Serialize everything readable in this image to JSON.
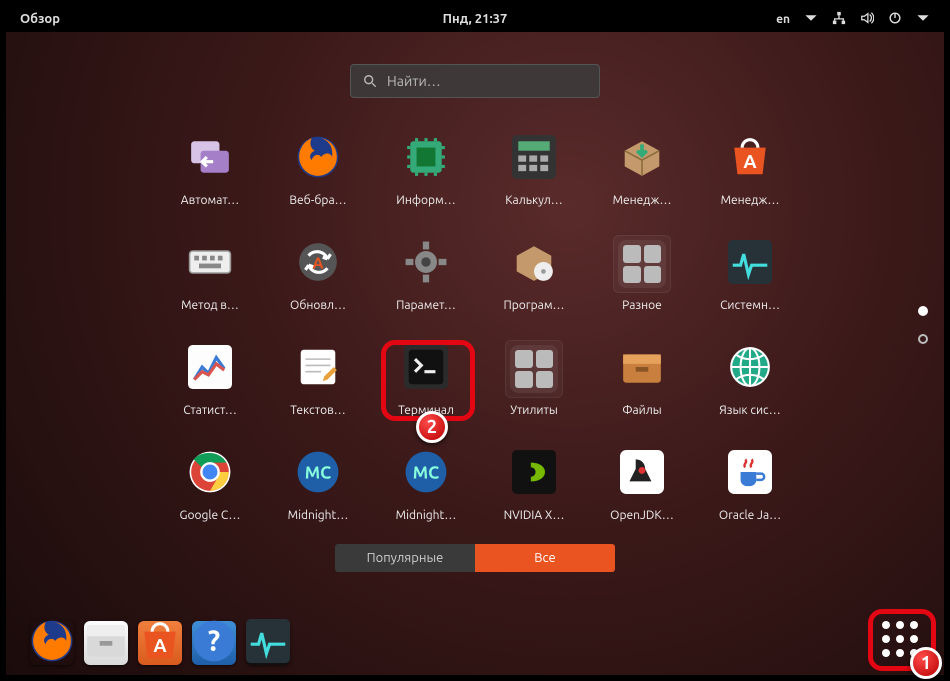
{
  "topbar": {
    "overview_label": "Обзор",
    "clock": "Пнд, 21:37",
    "lang": "en"
  },
  "search": {
    "placeholder": "Найти…"
  },
  "apps": [
    {
      "label": "Автомат…",
      "name": "app-startup",
      "icon": "window-arrow",
      "bg": "g-purple"
    },
    {
      "label": "Веб-бра…",
      "name": "app-firefox",
      "icon": "firefox",
      "bg": ""
    },
    {
      "label": "Информ…",
      "name": "app-sysinfo",
      "icon": "chip",
      "bg": "g-grey"
    },
    {
      "label": "Калькул…",
      "name": "app-calculator",
      "icon": "calc",
      "bg": "g-dark"
    },
    {
      "label": "Менедж…",
      "name": "app-archive",
      "icon": "box-down",
      "bg": "g-box"
    },
    {
      "label": "Менедж…",
      "name": "app-software",
      "icon": "bag-a",
      "bg": "g-orange"
    },
    {
      "label": "Метод в…",
      "name": "app-input-method",
      "icon": "keyboard",
      "bg": "g-white"
    },
    {
      "label": "Обновл…",
      "name": "app-updater",
      "icon": "refresh-a",
      "bg": "g-grey"
    },
    {
      "label": "Парамет…",
      "name": "app-settings",
      "icon": "gear",
      "bg": "g-grey"
    },
    {
      "label": "Програм…",
      "name": "app-software-prop",
      "icon": "box-cd",
      "bg": "g-box"
    },
    {
      "label": "Разное",
      "name": "folder-misc",
      "icon": "folder",
      "bg": "",
      "folder": true
    },
    {
      "label": "Системн…",
      "name": "app-sysmonitor",
      "icon": "ecg",
      "bg": "g-dark"
    },
    {
      "label": "Статист…",
      "name": "app-powerstats",
      "icon": "chart",
      "bg": "g-white"
    },
    {
      "label": "Текстов…",
      "name": "app-gedit",
      "icon": "notepad",
      "bg": "g-white"
    },
    {
      "label": "Терминал",
      "name": "app-terminal",
      "icon": "terminal",
      "bg": "g-dark",
      "highlighted": true,
      "badge": "2"
    },
    {
      "label": "Утилиты",
      "name": "folder-utilities",
      "icon": "folder",
      "bg": "",
      "folder": true
    },
    {
      "label": "Файлы",
      "name": "app-files",
      "icon": "drawer",
      "bg": "g-orange"
    },
    {
      "label": "Язык сис…",
      "name": "app-language",
      "icon": "globe",
      "bg": "g-teal"
    },
    {
      "label": "Google C…",
      "name": "app-chrome",
      "icon": "chrome",
      "bg": ""
    },
    {
      "label": "Midnight…",
      "name": "app-mc1",
      "icon": "mc",
      "bg": "g-blue"
    },
    {
      "label": "Midnight…",
      "name": "app-mc2",
      "icon": "mc",
      "bg": "g-blue"
    },
    {
      "label": "NVIDIA X…",
      "name": "app-nvidia",
      "icon": "nvidia",
      "bg": "g-dark"
    },
    {
      "label": "OpenJDK…",
      "name": "app-openjdk",
      "icon": "java-duke",
      "bg": "g-java"
    },
    {
      "label": "Oracle Ja…",
      "name": "app-oraclejava",
      "icon": "java-cup",
      "bg": "g-java"
    }
  ],
  "tabs": {
    "popular": "Популярные",
    "all": "Все",
    "active": "all"
  },
  "page_dots": {
    "count": 2,
    "active": 0
  },
  "dock": [
    {
      "name": "dock-firefox",
      "icon": "firefox",
      "bg": ""
    },
    {
      "name": "dock-files",
      "icon": "drawer-s",
      "bg": "g-white"
    },
    {
      "name": "dock-software",
      "icon": "bag-a",
      "bg": "g-orange"
    },
    {
      "name": "dock-help",
      "icon": "help",
      "bg": "g-blue"
    },
    {
      "name": "dock-sysmon",
      "icon": "ecg",
      "bg": "g-dark"
    }
  ],
  "annotations": {
    "show_apps_badge": "1"
  }
}
